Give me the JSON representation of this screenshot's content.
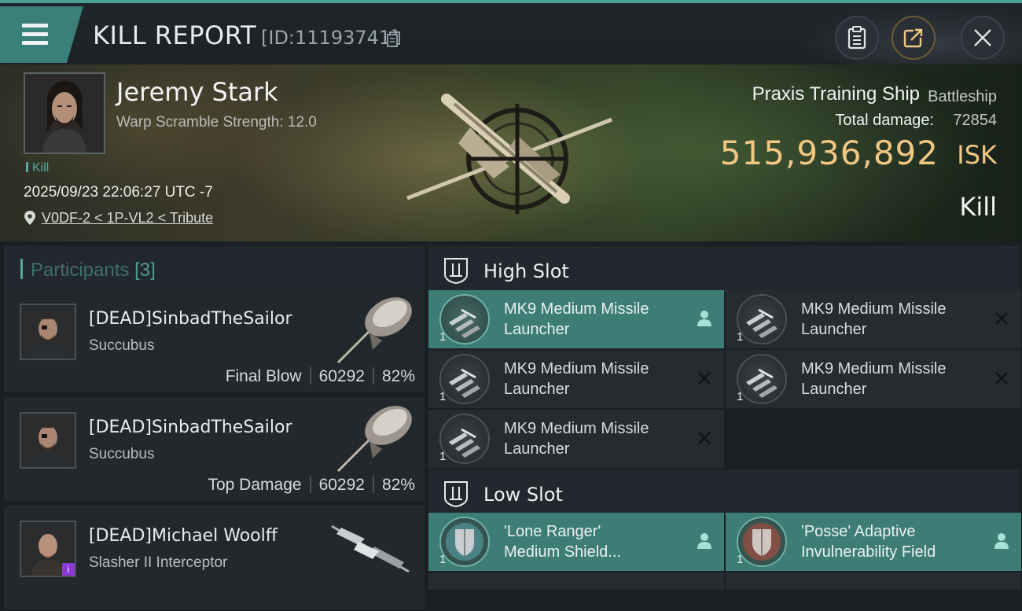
{
  "header": {
    "title": "KILL REPORT",
    "id_text": "[ID:11193741]"
  },
  "victim": {
    "name": "Jeremy Stark",
    "warp_scramble": "Warp Scramble Strength: 12.0",
    "tag": "Kill",
    "timestamp": "2025/09/23 22:06:27 UTC -7",
    "location": "V0DF-2 < 1P-VL2 < Tribute",
    "ship_name": "Praxis Training Ship",
    "ship_class": "Battleship",
    "damage_label": "Total damage:",
    "damage_value": "72854",
    "isk_value": "515,936,892",
    "isk_unit": "ISK",
    "result": "Kill"
  },
  "participants": {
    "title": "Participants",
    "count": "[3]",
    "items": [
      {
        "name": "[DEAD]SinbadTheSailor",
        "ship": "Succubus",
        "role": "Final Blow",
        "damage": "60292",
        "percent": "82%"
      },
      {
        "name": "[DEAD]SinbadTheSailor",
        "ship": "Succubus",
        "role": "Top Damage",
        "damage": "60292",
        "percent": "82%"
      },
      {
        "name": "[DEAD]Michael Woolff",
        "ship": "Slasher II Interceptor",
        "badge": "i"
      }
    ]
  },
  "fitting": {
    "high_slot": {
      "title": "High Slot",
      "modules": [
        {
          "name": "MK9 Medium Missile Launcher",
          "qty": "1",
          "state": "dropped",
          "icon": "missile-launcher-icon"
        },
        {
          "name": "MK9 Medium Missile Launcher",
          "qty": "1",
          "state": "destroyed",
          "icon": "missile-launcher-icon"
        },
        {
          "name": "MK9 Medium Missile Launcher",
          "qty": "1",
          "state": "destroyed",
          "icon": "missile-launcher-icon"
        },
        {
          "name": "MK9 Medium Missile Launcher",
          "qty": "1",
          "state": "destroyed",
          "icon": "missile-launcher-icon"
        },
        {
          "name": "MK9 Medium Missile Launcher",
          "qty": "1",
          "state": "destroyed",
          "icon": "missile-launcher-icon"
        }
      ]
    },
    "low_slot": {
      "title": "Low Slot",
      "modules": [
        {
          "name_line1": "'Lone Ranger'",
          "name_line2": "Medium Shield...",
          "qty": "1",
          "state": "dropped",
          "icon": "shield-module-icon"
        },
        {
          "name_line1": "'Posse' Adaptive",
          "name_line2": "Invulnerability Field",
          "qty": "1",
          "state": "dropped",
          "icon": "invulnerability-field-icon"
        }
      ]
    }
  },
  "colors": {
    "accent_teal": "#3d7d75",
    "isk_gold": "#f0c783",
    "panel": "#23282e"
  }
}
